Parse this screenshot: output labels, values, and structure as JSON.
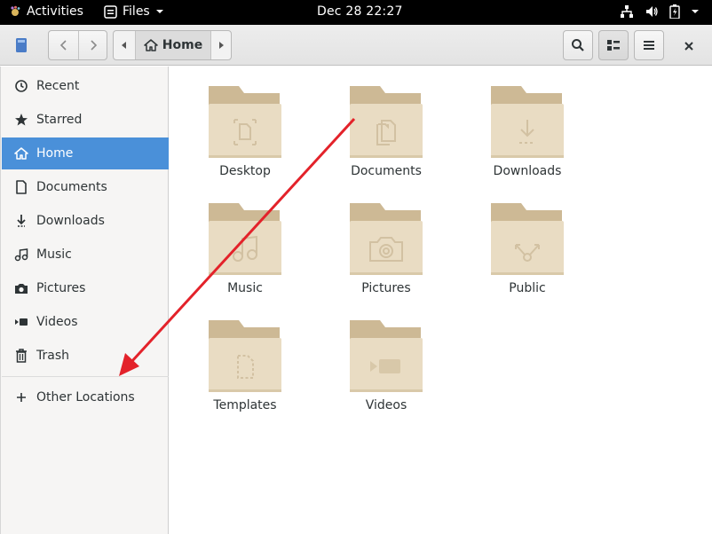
{
  "topbar": {
    "activities": "Activities",
    "app": "Files",
    "clock": "Dec 28  22:27"
  },
  "header": {
    "path_home": "Home"
  },
  "sidebar": {
    "items": [
      {
        "label": "Recent",
        "icon": "clock-icon"
      },
      {
        "label": "Starred",
        "icon": "star-icon"
      },
      {
        "label": "Home",
        "icon": "home-icon"
      },
      {
        "label": "Documents",
        "icon": "document-icon"
      },
      {
        "label": "Downloads",
        "icon": "download-icon"
      },
      {
        "label": "Music",
        "icon": "music-icon"
      },
      {
        "label": "Pictures",
        "icon": "camera-icon"
      },
      {
        "label": "Videos",
        "icon": "video-icon"
      },
      {
        "label": "Trash",
        "icon": "trash-icon"
      }
    ],
    "other_locations": "Other Locations"
  },
  "folders": [
    {
      "label": "Desktop",
      "emblem": "desktop"
    },
    {
      "label": "Documents",
      "emblem": "document"
    },
    {
      "label": "Downloads",
      "emblem": "download"
    },
    {
      "label": "Music",
      "emblem": "music"
    },
    {
      "label": "Pictures",
      "emblem": "camera"
    },
    {
      "label": "Public",
      "emblem": "share"
    },
    {
      "label": "Templates",
      "emblem": "template"
    },
    {
      "label": "Videos",
      "emblem": "video"
    }
  ],
  "colors": {
    "accent": "#4a90d9",
    "folder_body": "#e9dcc3",
    "folder_tab": "#cdb995",
    "annotation_arrow": "#e3222a"
  }
}
